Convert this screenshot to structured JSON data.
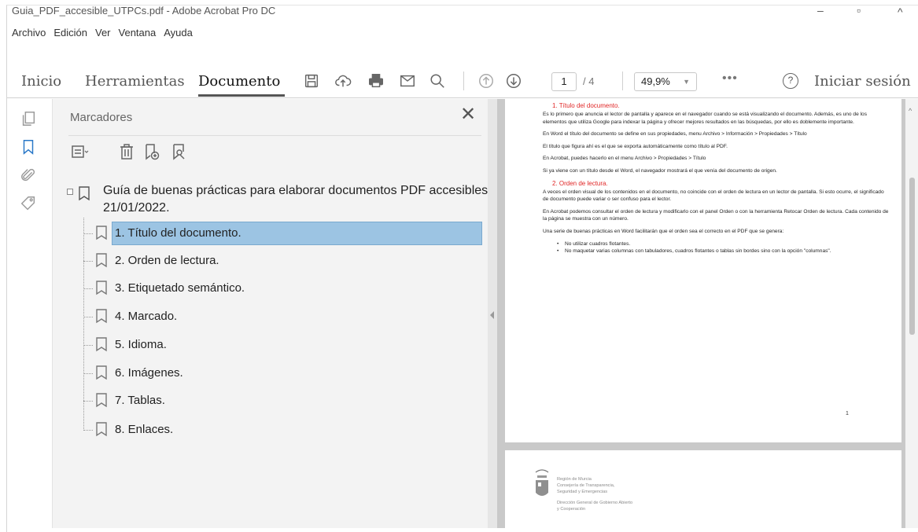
{
  "window": {
    "title": "Guia_PDF_accesible_UTPCs.pdf - Adobe Acrobat Pro DC",
    "controls": {
      "minimize": "–",
      "maximize": "▫",
      "close": "^"
    }
  },
  "menubar": {
    "items": [
      "Archivo",
      "Edición",
      "Ver",
      "Ventana",
      "Ayuda"
    ]
  },
  "toolbar": {
    "tabs": [
      "Inicio",
      "Herramientas",
      "Documento"
    ],
    "active_tab": "Documento",
    "icons": [
      "save-icon",
      "upload-cloud-icon",
      "print-icon",
      "mail-icon",
      "search-icon",
      "page-up-icon",
      "page-down-icon"
    ],
    "page_current": "1",
    "page_total": "/ 4",
    "zoom": "49,9%",
    "more": "•••",
    "help": "?",
    "sign_in": "Iniciar sesión"
  },
  "rail": {
    "icons": [
      "pages-icon",
      "bookmark-icon",
      "attachment-icon",
      "tag-icon"
    ],
    "active": "bookmark-icon"
  },
  "bookmarks_panel": {
    "title": "Marcadores",
    "close": "✕",
    "tools": [
      "options-menu-icon",
      "delete-bookmark-icon",
      "new-bookmark-icon",
      "search-bookmark-icon"
    ],
    "root": {
      "line1": "Guía de buenas prácticas para elaborar documentos PDF accesibles.",
      "line2": "21/01/2022."
    },
    "items": [
      "1. Título del documento.",
      "2. Orden de lectura.",
      "3. Etiquetado semántico.",
      "4. Marcado.",
      "5. Idioma.",
      "6. Imágenes.",
      "7. Tablas.",
      "8. Enlaces."
    ],
    "selected_index": 0,
    "selection_color": "#9cc4e3"
  },
  "document": {
    "s1_heading": "1.  Título del documento.",
    "s1_p1": "Es lo primero que anuncia el lector de pantalla y aparece en el navegador cuando se está visualizando el documento. Además, es uno de los elementos que utiliza Google para indexar la página y ofrecer mejores resultados en las búsquedas, por ello es doblemente importante.",
    "s1_p2": "En Word el título del documento se define en sus propiedades, menu Archivo > Información > Propiedades > Título",
    "s1_p3": "El título que figura ahí es el que se exporta automáticamente como título al PDF.",
    "s1_p4": "En Acrobat, puedes hacerlo en el menu Archivo > Propiedades > Título",
    "s1_p5": "Si ya viene con un título desde el Word, el navegador mostrará el que venía del documento de origen.",
    "s2_heading": "2.  Orden de lectura.",
    "s2_p1": "A veces el orden visual de los contenidos en el documento, no coincide con el orden de lectura en un lector de pantalla. Si esto ocurre, el significado de documento puede variar o ser confuso para el lector.",
    "s2_p2": "En Acrobat podemos consultar el orden de lectura y modificarlo con el panel Orden o con la herramienta Retocar Orden de lectura. Cada contenido de la página se muestra con un número.",
    "s2_p3": "Una serie de buenas prácticas en Word facilitarán que el orden sea el correcto en el PDF que se genera:",
    "s2_li1": "No utilizar cuadros flotantes.",
    "s2_li2": "No maquetar varias columnas con tabuladores, cuadros flotantes o tablas sin bordes sino con la opción \"columnas\".",
    "page_number": "1",
    "footer_org_line1": "Región de Murcia",
    "footer_org_line2": "Consejería de Transparencia,",
    "footer_org_line3": "Seguridad y Emergencias",
    "footer_org_line4": "Dirección General de Gobierno Abierto",
    "footer_org_line5": "y Cooperación",
    "heading_color": "#e02626"
  }
}
